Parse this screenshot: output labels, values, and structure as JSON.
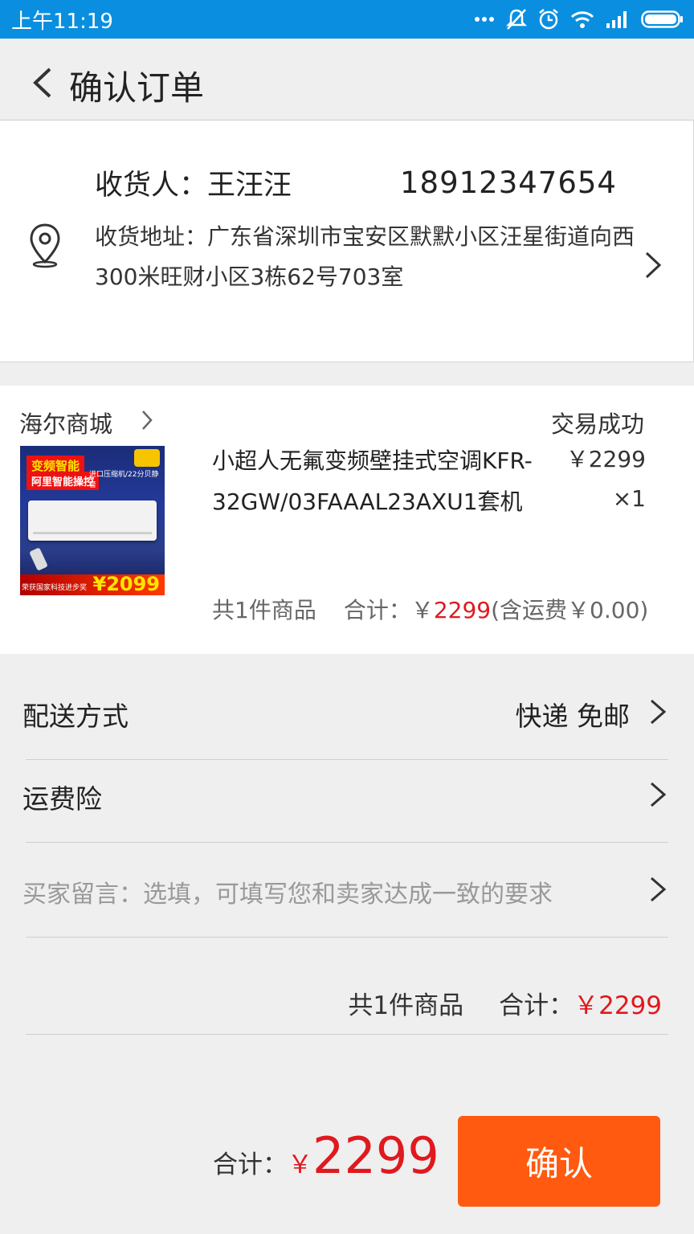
{
  "status_bar": {
    "time": "上午11:19",
    "icons": [
      "more-dots-icon",
      "mute-icon",
      "alarm-icon",
      "wifi-icon",
      "signal-icon",
      "battery-icon"
    ]
  },
  "header": {
    "title": "确认订单",
    "back_icon": "chevron-left-icon"
  },
  "address": {
    "receiver": "收货人：王汪汪",
    "phone": "18912347654",
    "address": "收货地址：广东省深圳市宝安区默默小区汪星街道向西300米旺财小区3栋62号703室"
  },
  "order": {
    "shop_name": "海尔商城",
    "status": "交易成功",
    "thumbnail": {
      "tag_line1": "变频智能",
      "tag_line2": "阿里智能操控",
      "subtitle": "进口压缩机/22分贝静音",
      "footer": "荣获国家科技进步奖",
      "price": "¥2099"
    },
    "product_name": "小超人无氟变频壁挂式空调KFR-32GW/03FAAAL23AXU1套机",
    "price": "￥2299",
    "quantity": "×1",
    "summary_count": "共1件商品",
    "summary_total_label": "合计：￥",
    "summary_total_value": "2299",
    "summary_shipping": "(含运费￥0.00)"
  },
  "rows": {
    "delivery_label": "配送方式",
    "delivery_value": "快递 免邮",
    "insurance_label": "运费险",
    "message_placeholder": "买家留言：选填，可填写您和卖家达成一致的要求"
  },
  "total": {
    "count": "共1件商品",
    "label": "合计：",
    "value": "￥2299"
  },
  "footer": {
    "label": "合计：",
    "currency": "￥",
    "amount": "2299",
    "confirm": "确认"
  },
  "colors": {
    "status_bar": "#0a8fe0",
    "price_red": "#e0191e",
    "confirm_button": "#ff5a0f",
    "background": "#efefef"
  }
}
